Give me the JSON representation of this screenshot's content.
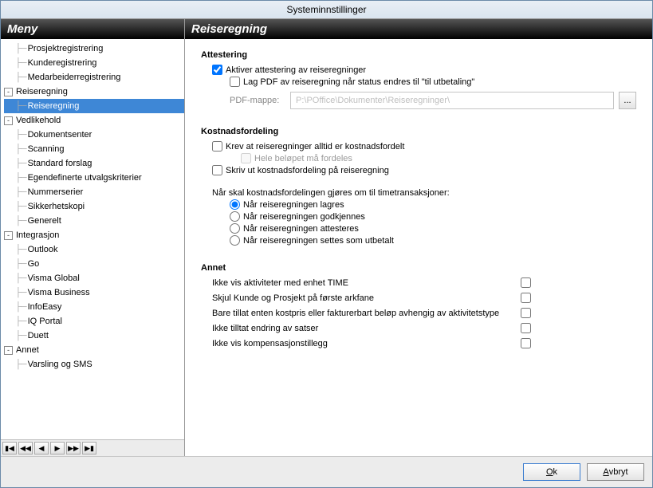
{
  "window": {
    "title": "Systeminnstillinger"
  },
  "sidebar": {
    "header": "Meny",
    "nodes": [
      {
        "indent": 2,
        "toggle": "",
        "label": "Prosjektregistrering"
      },
      {
        "indent": 2,
        "toggle": "",
        "label": "Kunderegistrering"
      },
      {
        "indent": 2,
        "toggle": "",
        "label": "Medarbeiderregistrering"
      },
      {
        "indent": 1,
        "toggle": "-",
        "label": "Reiseregning"
      },
      {
        "indent": 2,
        "toggle": "",
        "label": "Reiseregning",
        "selected": true
      },
      {
        "indent": 1,
        "toggle": "-",
        "label": "Vedlikehold"
      },
      {
        "indent": 2,
        "toggle": "",
        "label": "Dokumentsenter"
      },
      {
        "indent": 2,
        "toggle": "",
        "label": "Scanning"
      },
      {
        "indent": 2,
        "toggle": "",
        "label": "Standard forslag"
      },
      {
        "indent": 2,
        "toggle": "",
        "label": "Egendefinerte utvalgskriterier"
      },
      {
        "indent": 2,
        "toggle": "",
        "label": "Nummerserier"
      },
      {
        "indent": 2,
        "toggle": "",
        "label": "Sikkerhetskopi"
      },
      {
        "indent": 2,
        "toggle": "",
        "label": "Generelt"
      },
      {
        "indent": 1,
        "toggle": "-",
        "label": "Integrasjon"
      },
      {
        "indent": 2,
        "toggle": "",
        "label": "Outlook"
      },
      {
        "indent": 2,
        "toggle": "",
        "label": "Go"
      },
      {
        "indent": 2,
        "toggle": "",
        "label": "Visma Global"
      },
      {
        "indent": 2,
        "toggle": "",
        "label": "Visma Business"
      },
      {
        "indent": 2,
        "toggle": "",
        "label": "InfoEasy"
      },
      {
        "indent": 2,
        "toggle": "",
        "label": "IQ Portal"
      },
      {
        "indent": 2,
        "toggle": "",
        "label": "Duett"
      },
      {
        "indent": 1,
        "toggle": "-",
        "label": "Annet"
      },
      {
        "indent": 2,
        "toggle": "",
        "label": "Varsling og SMS"
      }
    ]
  },
  "panel": {
    "header": "Reiseregning",
    "attestering": {
      "title": "Attestering",
      "activate": "Aktiver attestering av reiseregninger",
      "lag_pdf": "Lag PDF av reiseregning når status endres til \"til utbetaling\"",
      "pdf_label": "PDF-mappe:",
      "pdf_value": "P:\\POffice\\Dokumenter\\Reiseregninger\\",
      "browse": "..."
    },
    "kostnads": {
      "title": "Kostnadsfordeling",
      "krev": "Krev at reiseregninger alltid er kostnadsfordelt",
      "hele": "Hele beløpet må fordeles",
      "skriv": "Skriv ut kostnadsfordeling på reiseregning",
      "radio_title": "Når skal kostnadsfordelingen gjøres om til timetransaksjoner:",
      "radios": [
        "Når reiseregningen lagres",
        "Når reiseregningen godkjennes",
        "Når reiseregningen attesteres",
        "Når reiseregningen settes som utbetalt"
      ]
    },
    "annet": {
      "title": "Annet",
      "items": [
        "Ikke vis aktiviteter med enhet TIME",
        "Skjul Kunde og Prosjekt på første arkfane",
        "Bare tillat enten kostpris eller fakturerbart beløp avhengig av aktivitetstype",
        "Ikke tilltat endring av satser",
        "Ikke vis  kompensasjonstillegg"
      ]
    }
  },
  "footer": {
    "ok": "Ok",
    "cancel": "Avbryt"
  }
}
